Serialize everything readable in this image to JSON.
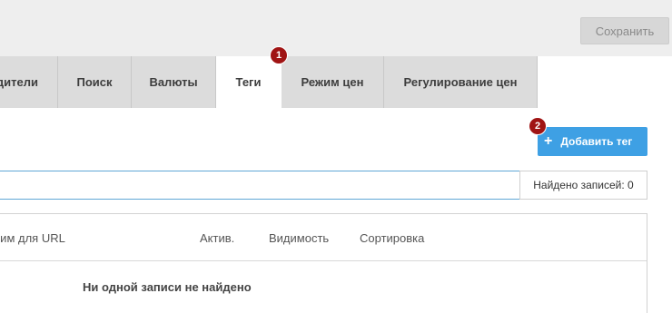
{
  "header": {
    "save_label": "Сохранить"
  },
  "tabs": [
    {
      "label": "дители",
      "active": false
    },
    {
      "label": "Поиск",
      "active": false
    },
    {
      "label": "Валюты",
      "active": false
    },
    {
      "label": "Теги",
      "active": true
    },
    {
      "label": "Режим цен",
      "active": false
    },
    {
      "label": "Регулирование цен",
      "active": false
    }
  ],
  "badges": {
    "tabs_hint": "1",
    "add_hint": "2"
  },
  "toolbar": {
    "add_label": "Добавить тег",
    "add_icon": "plus-icon"
  },
  "search": {
    "value": "",
    "found_label": "Найдено записей: 0"
  },
  "table": {
    "columns": [
      "ним для URL",
      "Актив.",
      "Видимость",
      "Сортировка"
    ],
    "empty_message": "Ни одной записи не найдено"
  },
  "colors": {
    "accent": "#3ea0e4",
    "badge": "#a01414",
    "tab_bg": "#dcdcdc",
    "topbar_bg": "#eeeeee"
  }
}
